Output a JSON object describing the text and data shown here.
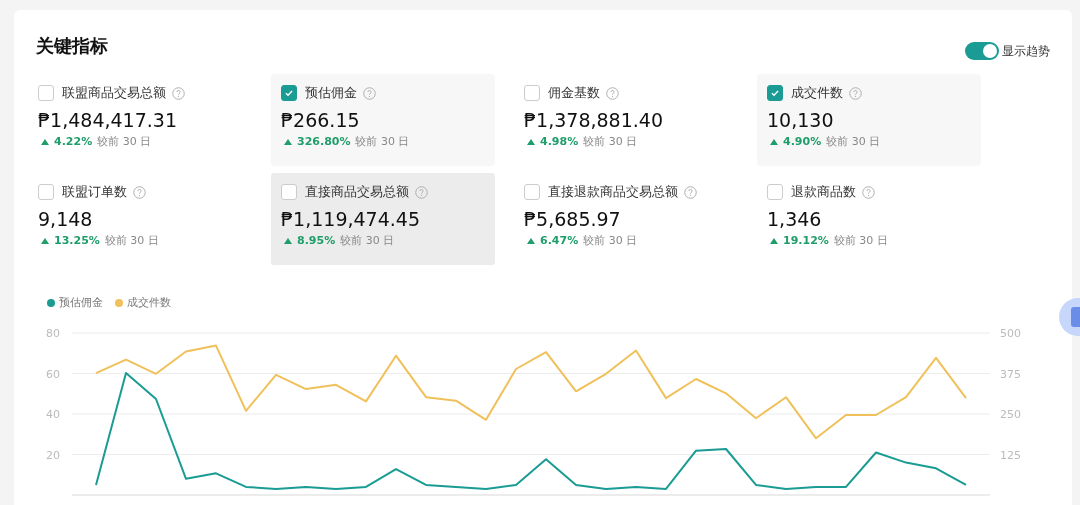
{
  "title": "关键指标",
  "trend_toggle": {
    "label": "显示趋势",
    "on": true
  },
  "metrics": [
    {
      "label": "联盟商品交易总额",
      "value": "₱1,484,417.31",
      "change": "4.22%",
      "compare": "较前 30 日",
      "checked": false,
      "hovered": false
    },
    {
      "label": "预估佣金",
      "value": "₱266.15",
      "change": "326.80%",
      "compare": "较前 30 日",
      "checked": true,
      "hovered": false
    },
    {
      "label": "佣金基数",
      "value": "₱1,378,881.40",
      "change": "4.98%",
      "compare": "较前 30 日",
      "checked": false,
      "hovered": false
    },
    {
      "label": "成交件数",
      "value": "10,130",
      "change": "4.90%",
      "compare": "较前 30 日",
      "checked": true,
      "hovered": false
    },
    {
      "label": "联盟订单数",
      "value": "9,148",
      "change": "13.25%",
      "compare": "较前 30 日",
      "checked": false,
      "hovered": false
    },
    {
      "label": "直接商品交易总额",
      "value": "₱1,119,474.45",
      "change": "8.95%",
      "compare": "较前 30 日",
      "checked": false,
      "hovered": true
    },
    {
      "label": "直接退款商品交易总额",
      "value": "₱5,685.97",
      "change": "6.47%",
      "compare": "较前 30 日",
      "checked": false,
      "hovered": false
    },
    {
      "label": "退款商品数",
      "value": "1,346",
      "change": "19.12%",
      "compare": "较前 30 日",
      "checked": false,
      "hovered": false
    }
  ],
  "chart": {
    "chart_data": {
      "type": "line",
      "grid": true,
      "ylim": [
        0,
        80
      ],
      "yticks": [
        20,
        40,
        60,
        80
      ],
      "y2lim": [
        0,
        500
      ],
      "y2ticks": [
        125,
        250,
        375,
        500
      ],
      "series": [
        {
          "name": "预估佣金",
          "color": "#1a9b94",
          "values": [
            5,
            60.2,
            47.4,
            8,
            10.7,
            4,
            3,
            4,
            3,
            4,
            12.8,
            5,
            4,
            3,
            5,
            17.7,
            5,
            3,
            4,
            3,
            21.9,
            22.7,
            5,
            3,
            4,
            4,
            21,
            16,
            13.2,
            5
          ]
        },
        {
          "name": "成交件数",
          "color": "#f0c05a",
          "axis": "y2",
          "values": [
            376,
            418,
            374,
            443,
            461,
            260,
            371,
            327,
            340,
            289,
            430,
            302,
            291,
            232,
            389,
            441,
            320,
            374,
            446,
            299,
            358,
            314,
            237,
            302,
            175,
            247,
            247,
            302,
            423,
            299
          ]
        }
      ]
    }
  }
}
